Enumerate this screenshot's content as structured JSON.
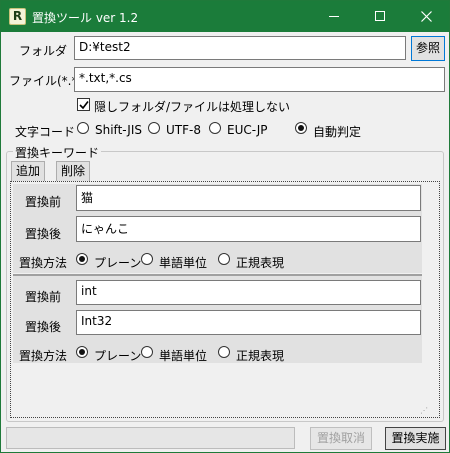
{
  "window": {
    "app_icon_letter": "R",
    "title": "置換ツール ver 1.2",
    "accent_color": "#1b7c3a"
  },
  "folder": {
    "label": "フォルダ",
    "value": "D:¥test2",
    "browse_label": "参照"
  },
  "file": {
    "label": "ファイル(*.*)",
    "value": "*.txt,*.cs"
  },
  "skip_hidden": {
    "label": "隠しフォルダ/ファイルは処理しない",
    "checked": true
  },
  "encoding": {
    "label": "文字コード",
    "options": [
      "Shift-JIS",
      "UTF-8",
      "EUC-JP",
      "自動判定"
    ],
    "selected": "自動判定"
  },
  "keywords": {
    "group_title": "置換キーワード",
    "add_label": "追加",
    "delete_label": "削除",
    "before_label": "置換前",
    "after_label": "置換後",
    "method_label": "置換方法",
    "method_options": [
      "プレーン",
      "単語単位",
      "正規表現"
    ],
    "entries": [
      {
        "before": "猫",
        "after": "にゃんこ",
        "method": "プレーン"
      },
      {
        "before": "int",
        "after": "Int32",
        "method": "プレーン"
      }
    ]
  },
  "footer": {
    "cancel_label": "置換取消",
    "run_label": "置換実施"
  }
}
